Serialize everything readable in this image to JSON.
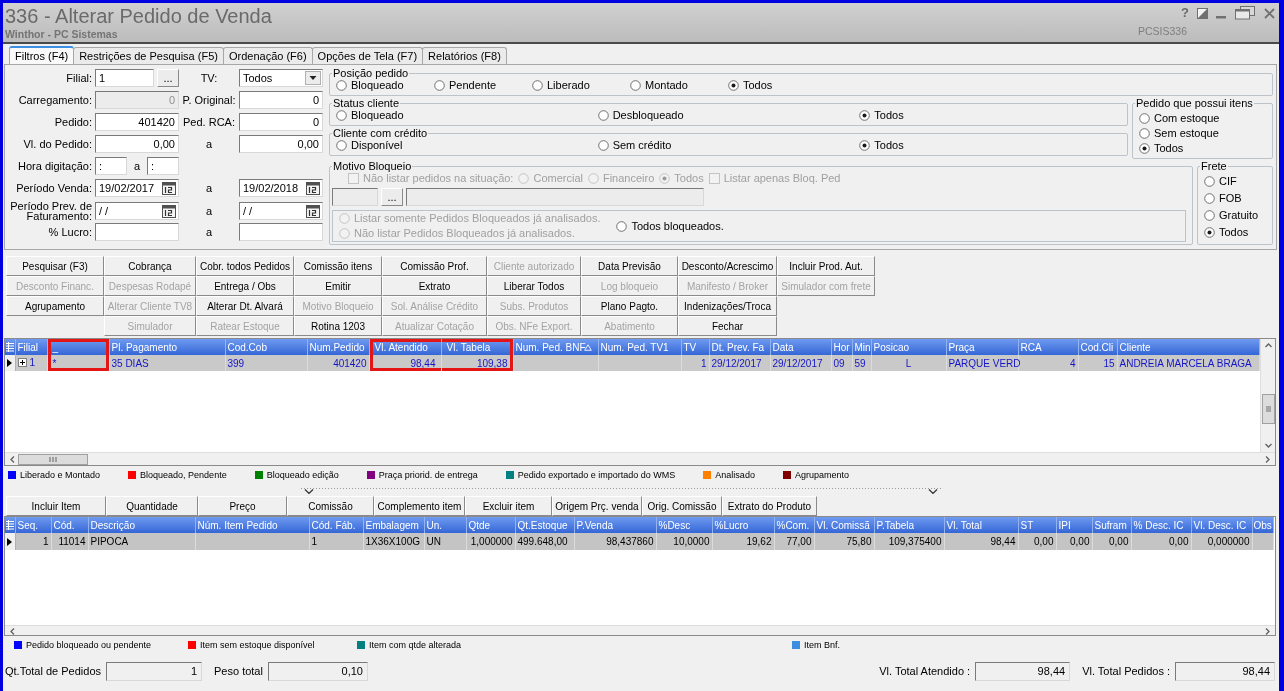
{
  "window": {
    "title": "336 - Alterar Pedido de Venda",
    "subtitle": "Winthor - PC Sistemas",
    "help": "?",
    "code": "PCSIS336"
  },
  "tabs": [
    {
      "label": "Filtros (F4)",
      "selected": true
    },
    {
      "label": "Restrições de Pesquisa (F5)",
      "selected": false
    },
    {
      "label": "Ordenação (F6)",
      "selected": false
    },
    {
      "label": "Opções de Tela (F7)",
      "selected": false
    },
    {
      "label": "Relatórios (F8)",
      "selected": false
    }
  ],
  "filter_rows": [
    {
      "label": "Filial:",
      "field": {
        "kind": "lookup",
        "value": "1",
        "button": "...",
        "disabled": false
      },
      "label2": "TV:",
      "field2": {
        "kind": "select",
        "value": "Todos",
        "disabled": false
      }
    },
    {
      "label": "Carregamento:",
      "field": {
        "kind": "number",
        "value": "0",
        "disabled": true
      },
      "label2": "P. Original:",
      "field2": {
        "kind": "number",
        "value": "0",
        "disabled": false
      }
    },
    {
      "label": "Pedido:",
      "field": {
        "kind": "number",
        "value": "401420",
        "disabled": false
      },
      "label2": "Ped. RCA:",
      "field2": {
        "kind": "number",
        "value": "0",
        "disabled": false
      }
    },
    {
      "label": "Vl. do Pedido:",
      "field": {
        "kind": "number",
        "value": "0,00",
        "disabled": false
      },
      "label2": "a",
      "field2": {
        "kind": "number",
        "value": "0,00",
        "disabled": false
      }
    },
    {
      "label": "Hora digitação:",
      "field": {
        "kind": "time_range",
        "value": ":",
        "separator": "a",
        "value2": ":",
        "disabled": false
      }
    },
    {
      "label": "Período Venda:",
      "field": {
        "kind": "date",
        "value": "19/02/2017",
        "disabled": false
      },
      "label2": "a",
      "field2": {
        "kind": "date",
        "value": "19/02/2018",
        "disabled": false
      }
    },
    {
      "label": "Período Prev. de Faturamento:",
      "field": {
        "kind": "date",
        "value": "/ /",
        "disabled": false
      },
      "label2": "a",
      "field2": {
        "kind": "date",
        "value": "/ /",
        "disabled": false
      }
    },
    {
      "label": "% Lucro:",
      "field": {
        "kind": "text",
        "disabled": false
      },
      "label2": "a",
      "field2": {
        "kind": "text",
        "disabled": false
      }
    }
  ],
  "posicao_pedido": {
    "title": "Posição pedido",
    "options": [
      {
        "label": "Bloqueado",
        "selected": false
      },
      {
        "label": "Pendente",
        "selected": false
      },
      {
        "label": "Liberado",
        "selected": false
      },
      {
        "label": "Montado",
        "selected": false
      },
      {
        "label": "Todos",
        "selected": true
      }
    ]
  },
  "status_cliente": {
    "title": "Status cliente",
    "options": [
      {
        "label": "Bloqueado",
        "selected": false
      },
      {
        "label": "Desbloqueado",
        "selected": false
      },
      {
        "label": "Todos",
        "selected": true
      }
    ]
  },
  "cliente_credito": {
    "title": "Cliente com crédito",
    "options": [
      {
        "label": "Disponível",
        "selected": false
      },
      {
        "label": "Sem crédito",
        "selected": false
      },
      {
        "label": "Todos",
        "selected": true
      }
    ]
  },
  "pedido_itens": {
    "title": "Pedido que possui itens",
    "options": [
      {
        "label": "Com estoque",
        "selected": false
      },
      {
        "label": "Sem estoque",
        "selected": false
      },
      {
        "label": "Todos",
        "selected": true
      }
    ]
  },
  "motivo_bloqueio": {
    "title": "Motivo Bloqueio",
    "exclude_check": {
      "label": "Não listar pedidos na situação:",
      "checked": false,
      "disabled": true
    },
    "situacao": [
      {
        "label": "Comercial",
        "selected": false,
        "disabled": true
      },
      {
        "label": "Financeiro",
        "selected": false,
        "disabled": true
      },
      {
        "label": "Todos",
        "selected": true,
        "disabled": true
      }
    ],
    "bloq_check": {
      "label": "Listar apenas Bloq. Ped",
      "checked": false,
      "disabled": true
    },
    "code_field": {
      "disabled": true
    },
    "lookup_button": "...",
    "description_field": {
      "disabled": true
    },
    "analysis": [
      {
        "label": "Listar somente Pedidos Bloqueados já analisados.",
        "selected": false,
        "disabled": true
      },
      {
        "label": "Não listar Pedidos Bloqueados já analisados.",
        "selected": false,
        "disabled": true
      },
      {
        "label": "Todos bloqueados.",
        "selected": false,
        "disabled": false
      }
    ]
  },
  "frete": {
    "title": "Frete",
    "options": [
      {
        "label": "CIF",
        "selected": false
      },
      {
        "label": "FOB",
        "selected": false
      },
      {
        "label": "Gratuito",
        "selected": false
      },
      {
        "label": "Todos",
        "selected": true
      }
    ]
  },
  "action_buttons": [
    [
      {
        "kind": "button",
        "label": "Pesquisar (F3)",
        "disabled": false
      },
      {
        "kind": "button",
        "label": "Cobrança",
        "disabled": false
      },
      {
        "kind": "button",
        "label": "Cobr. todos Pedidos",
        "disabled": false
      },
      {
        "kind": "button",
        "label": "Comissão itens",
        "disabled": false
      },
      {
        "kind": "button",
        "label": "Comissão Prof.",
        "disabled": false
      },
      {
        "kind": "button",
        "label": "Cliente autorizado",
        "disabled": true
      },
      {
        "kind": "button",
        "label": "Data Previsão",
        "disabled": false
      },
      {
        "kind": "button",
        "label": "Desconto/Acrescimo",
        "disabled": false
      },
      {
        "kind": "button",
        "label": "Incluir Prod. Aut.",
        "disabled": false
      }
    ],
    [
      {
        "kind": "button",
        "label": "Desconto Financ.",
        "disabled": true
      },
      {
        "kind": "button",
        "label": "Despesas Rodapé",
        "disabled": true
      },
      {
        "kind": "button",
        "label": "Entrega / Obs",
        "disabled": false
      },
      {
        "kind": "button",
        "label": "Emitir",
        "disabled": false
      },
      {
        "kind": "button",
        "label": "Extrato",
        "disabled": false
      },
      {
        "kind": "button",
        "label": "Liberar Todos",
        "disabled": false
      },
      {
        "kind": "button",
        "label": "Log bloqueio",
        "disabled": true
      },
      {
        "kind": "button",
        "label": "Manifesto / Broker",
        "disabled": true
      },
      {
        "kind": "button",
        "label": "Simulador com frete",
        "disabled": true
      }
    ],
    [
      {
        "kind": "button",
        "label": "Agrupamento",
        "disabled": false
      },
      {
        "kind": "button",
        "label": "Alterar Cliente TV8",
        "disabled": true
      },
      {
        "kind": "button",
        "label": "Alterar Dt. Alvará",
        "disabled": false
      },
      {
        "kind": "button",
        "label": "Motivo Bloqueio",
        "disabled": true
      },
      {
        "kind": "button",
        "label": "Sol. Análise Crédito",
        "disabled": true
      },
      {
        "kind": "button",
        "label": "Subs. Produtos",
        "disabled": true
      },
      {
        "kind": "button",
        "label": "Plano Pagto.",
        "disabled": false
      },
      {
        "kind": "button",
        "label": "Indenizações/Troca",
        "disabled": false
      },
      {
        "kind": "gap"
      }
    ],
    [
      {
        "kind": "gap"
      },
      {
        "kind": "button",
        "label": "Simulador",
        "disabled": true
      },
      {
        "kind": "button",
        "label": "Ratear Estoque",
        "disabled": true
      },
      {
        "kind": "button",
        "label": "Rotina 1203",
        "disabled": false
      },
      {
        "kind": "button",
        "label": "Atualizar Cotação",
        "disabled": true
      },
      {
        "kind": "button",
        "label": "Obs. NFe Export.",
        "disabled": true
      },
      {
        "kind": "button",
        "label": "Abatimento",
        "disabled": true
      },
      {
        "kind": "button",
        "label": "Fechar",
        "disabled": false
      },
      {
        "kind": "gap"
      }
    ]
  ],
  "orders_grid": {
    "columns": [
      {
        "label": "Filial",
        "highlighted": false,
        "sorted": false
      },
      {
        "label": "_",
        "highlighted": true,
        "sorted": false
      },
      {
        "label": "Pl. Pagamento",
        "highlighted": false,
        "sorted": false
      },
      {
        "label": "Cod.Cob",
        "highlighted": false,
        "sorted": false
      },
      {
        "label": "Num.Pedido",
        "highlighted": false,
        "sorted": false
      },
      {
        "label": "Vl. Atendido",
        "highlighted": true,
        "sorted": false
      },
      {
        "label": "Vl. Tabela",
        "highlighted": true,
        "sorted": false
      },
      {
        "label": "Num. Ped. BNF",
        "highlighted": false,
        "sorted": true
      },
      {
        "label": "Num. Ped. TV1",
        "highlighted": false,
        "sorted": false
      },
      {
        "label": "TV",
        "highlighted": false,
        "sorted": false
      },
      {
        "label": "Dt. Prev. Fa",
        "highlighted": false,
        "sorted": false
      },
      {
        "label": "Data",
        "highlighted": false,
        "sorted": false
      },
      {
        "label": "Hor",
        "highlighted": false,
        "sorted": false
      },
      {
        "label": "Min",
        "highlighted": false,
        "sorted": false
      },
      {
        "label": "Posicao",
        "highlighted": false,
        "sorted": false
      },
      {
        "label": "Praça",
        "highlighted": false,
        "sorted": false
      },
      {
        "label": "RCA",
        "highlighted": false,
        "sorted": false
      },
      {
        "label": "Cod.Cli",
        "highlighted": false,
        "sorted": false
      },
      {
        "label": "Cliente",
        "highlighted": false,
        "sorted": false
      }
    ],
    "rows": [
      {
        "selected": true,
        "expanded": false,
        "cells": [
          "1",
          "*",
          "35 DIAS",
          "399",
          "401420",
          "98,44",
          "109,38",
          null,
          null,
          "1",
          "29/12/2017",
          "29/12/2017",
          "09",
          "59",
          "L",
          "PARQUE VERD",
          "4",
          "15",
          "ANDREIA MARCELA BRAGA"
        ]
      }
    ]
  },
  "orders_legend": [
    {
      "label": "Liberado e Montado",
      "color": "#0000ff"
    },
    {
      "label": "Bloqueado, Pendente",
      "color": "#ff0000"
    },
    {
      "label": "Bloqueado edição",
      "color": "#008000"
    },
    {
      "label": "Praça priorid. de entrega",
      "color": "#800080"
    },
    {
      "label": "Pedido exportado e importado do WMS",
      "color": "#008080"
    },
    {
      "label": "Analisado",
      "color": "#ff8000"
    },
    {
      "label": "Agrupamento",
      "color": "#800000"
    }
  ],
  "item_buttons": [
    "Incluir Item",
    "Quantidade",
    "Preço",
    "Comissão",
    "Complemento item",
    "Excluir item",
    "Origem Prç. venda",
    "Orig. Comissão",
    "Extrato do Produto"
  ],
  "items_grid": {
    "columns": [
      "Seq.",
      "Cód.",
      "Descrição",
      "Núm. Item Pedido",
      "Cód. Fáb.",
      "Embalagem",
      "Un.",
      "Qtde",
      "Qt.Estoque",
      "P.Venda",
      "%Desc",
      "%Lucro",
      "%Com.",
      "Vl. Comissã",
      "P.Tabela",
      "Vl. Total",
      "ST",
      "IPI",
      "Sufram",
      "% Desc. IC",
      "Vl. Desc. IC",
      "Obs"
    ],
    "rows": [
      {
        "selected": true,
        "cells": [
          "1",
          "11014",
          "PIPOCA",
          null,
          "1",
          "1X36X100G",
          "UN",
          "1,000000",
          "499.648,00",
          "98,437860",
          "10,0000",
          "19,62",
          "77,00",
          "75,80",
          "109,375400",
          "98,44",
          "0,00",
          "0,00",
          "0,00",
          "0,00",
          "0,000000",
          null
        ]
      }
    ]
  },
  "items_legend": [
    {
      "label": "Pedido bloqueado ou pendente",
      "color": "#0000ff"
    },
    {
      "label": "Item sem estoque disponível",
      "color": "#ff0000"
    },
    {
      "label": "Item com qtde alterada",
      "color": "#008080"
    },
    {
      "label": "Item Bnf.",
      "color": "#3c8ce0"
    }
  ],
  "totals": [
    {
      "label": "Qt.Total de Pedidos",
      "value": "1"
    },
    {
      "label": "Peso total",
      "value": "0,10"
    },
    {
      "label": "Vl. Total Atendido :",
      "value": "98,44"
    },
    {
      "label": "Vl. Total Pedidos :",
      "value": "98,44"
    }
  ]
}
